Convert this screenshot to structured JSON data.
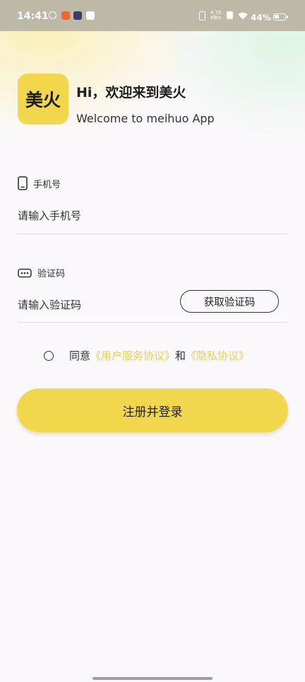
{
  "status_bar": {
    "time": "14:41",
    "net_speed": "4.70",
    "net_unit": "KB/s",
    "battery": "44%",
    "colors": {
      "app1": "#4B4B4B",
      "app2": "#F2652D",
      "app3": "#3D3A6E",
      "app4": "#FFFFFF"
    }
  },
  "brand": {
    "logo_text": "美火",
    "greeting": "Hi，欢迎来到美火",
    "subtitle": "Welcome to meihuo App",
    "accent": "#F2D74C"
  },
  "form": {
    "phone": {
      "label": "手机号",
      "placeholder": "请输入手机号",
      "icon": "phone-icon"
    },
    "code": {
      "label": "验证码",
      "placeholder": "请输入验证码",
      "icon": "password-dots-icon",
      "button": "获取验证码"
    }
  },
  "agreement": {
    "prefix": "同意",
    "user_agreement": "《用户服务协议》",
    "connector": "和",
    "privacy": "《隐私协议》",
    "link_color": "#EFCF58"
  },
  "submit_label": "注册并登录"
}
